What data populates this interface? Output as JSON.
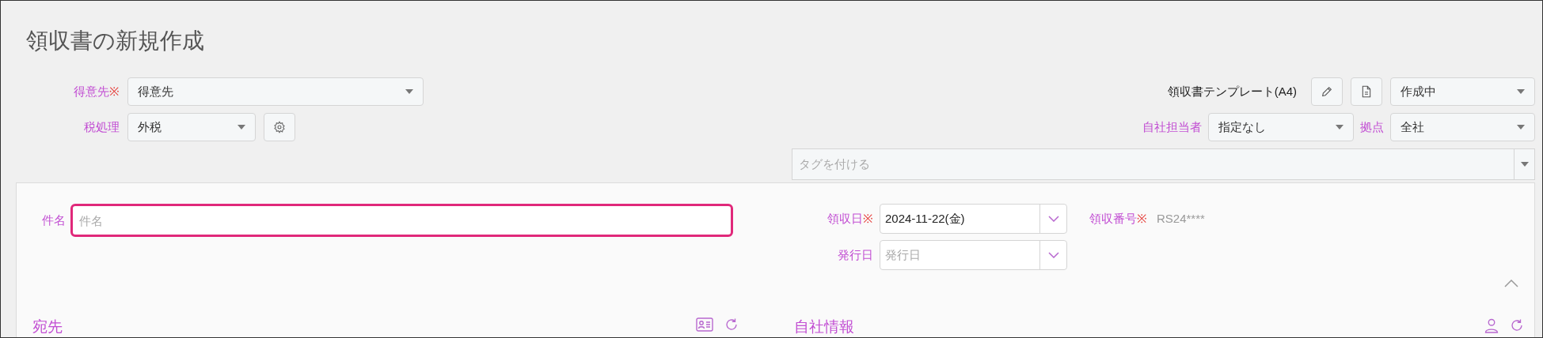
{
  "title": "領収書の新規作成",
  "customer": {
    "label": "得意先",
    "required_mark": "※",
    "value": "得意先"
  },
  "tax": {
    "label": "税処理",
    "value": "外税"
  },
  "template": {
    "label": "領収書テンプレート(A4)",
    "status": "作成中"
  },
  "staff": {
    "label": "自社担当者",
    "value": "指定なし"
  },
  "branch": {
    "label": "拠点",
    "value": "全社"
  },
  "tags": {
    "placeholder": "タグを付ける"
  },
  "subject": {
    "label": "件名",
    "placeholder": "件名",
    "focused": true
  },
  "receipt_date": {
    "label": "領収日",
    "required_mark": "※",
    "value": "2024-11-22(金)"
  },
  "issue_date": {
    "label": "発行日",
    "placeholder": "発行日"
  },
  "receipt_number": {
    "label": "領収番号",
    "required_mark": "※",
    "value": "RS24****"
  },
  "sections": [
    {
      "title": "宛先",
      "icons": [
        {
          "kind": "id-card"
        },
        {
          "kind": "refresh"
        }
      ]
    },
    {
      "title": "自社情報",
      "icons": [
        {
          "kind": "person"
        },
        {
          "kind": "refresh"
        }
      ]
    }
  ]
}
